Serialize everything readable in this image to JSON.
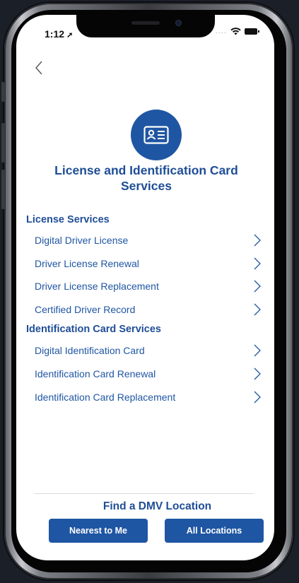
{
  "status_bar": {
    "time": "1:12",
    "signal": "....",
    "wifi": "wifi-icon",
    "battery": "battery-icon"
  },
  "nav": {
    "back": "back-chevron-icon"
  },
  "header": {
    "icon": "id-card-icon",
    "title": "License and Identification Card Services"
  },
  "license_services": {
    "heading": "License Services",
    "items": [
      {
        "label": "Digital Driver License"
      },
      {
        "label": "Driver License Renewal"
      },
      {
        "label": "Driver License Replacement"
      },
      {
        "label": "Certified Driver Record"
      }
    ]
  },
  "id_services": {
    "heading": "Identification Card Services",
    "items": [
      {
        "label": "Digital Identification Card"
      },
      {
        "label": "Identification Card Renewal"
      },
      {
        "label": "Identification Card Replacement"
      }
    ]
  },
  "footer": {
    "title": "Find a DMV Location",
    "nearest_label": "Nearest to Me",
    "all_label": "All Locations"
  },
  "colors": {
    "brand_blue": "#1f56a3",
    "heading_blue": "#1f4e97"
  }
}
